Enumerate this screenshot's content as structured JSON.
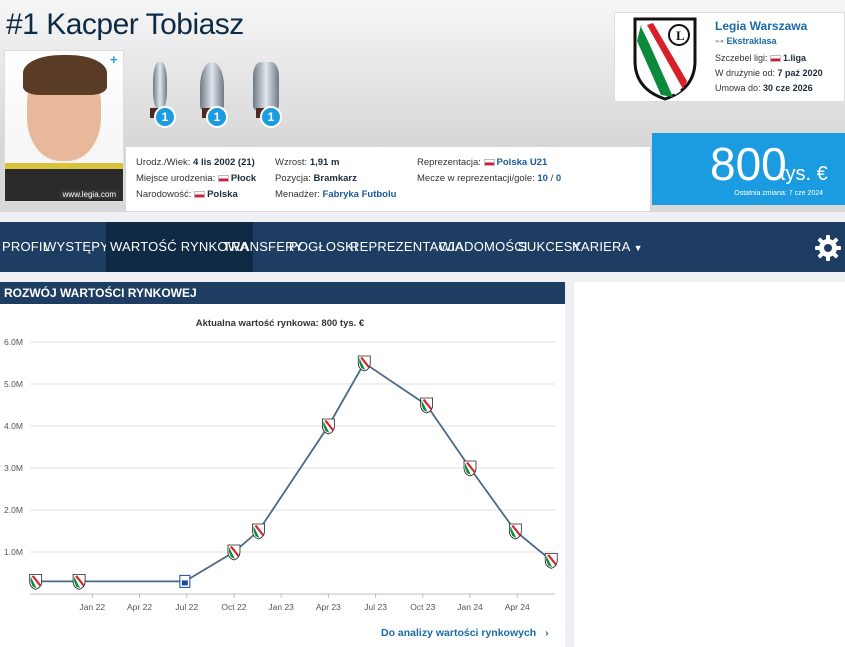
{
  "player": {
    "number": "#1",
    "first_name": "Kacper",
    "last_name": "Tobiasz",
    "photo_credit": "www.legia.com"
  },
  "trophies": [
    {
      "count": "1",
      "icon": "trophy-icon"
    },
    {
      "count": "1",
      "icon": "trophy-icon"
    },
    {
      "count": "1",
      "icon": "trophy-icon"
    }
  ],
  "details": {
    "birth_label": "Urodz./Wiek:",
    "birth_value": "4 lis 2002 (21)",
    "birthplace_label": "Miejsce urodzenia:",
    "birthplace_value": "Płock",
    "nationality_label": "Narodowość:",
    "nationality_value": "Polska",
    "height_label": "Wzrost:",
    "height_value": "1,91 m",
    "position_label": "Pozycja:",
    "position_value": "Bramkarz",
    "agent_label": "Menadżer:",
    "agent_value": "Fabryka Futbolu",
    "national_label": "Reprezentacja:",
    "national_value": "Polska U21",
    "caps_label": "Mecze w reprezentacji/gole:",
    "caps_value": "10",
    "goals_value": "0"
  },
  "club": {
    "name": "Legia Warszawa",
    "league": "Ekstraklasa",
    "tier_label": "Szczebel ligi:",
    "tier_value": "1.liga",
    "joined_label": "W drużynie od:",
    "joined_value": "7 paź 2020",
    "contract_label": "Umowa do:",
    "contract_value": "30 cze 2026"
  },
  "market_value": {
    "amount": "800",
    "unit": "tys. €",
    "last_change": "Ostatnia zmiana: 7 cze 2024"
  },
  "nav": [
    {
      "label": "PROFIL",
      "dropdown": false
    },
    {
      "label": "WYSTĘPY",
      "dropdown": true
    },
    {
      "label": "WARTOŚĆ RYNKOWA",
      "dropdown": false,
      "active": true
    },
    {
      "label": "TRANSFERY",
      "dropdown": false
    },
    {
      "label": "POGŁOSKI",
      "dropdown": false
    },
    {
      "label": "REPREZENTACJA",
      "dropdown": false
    },
    {
      "label": "WIADOMOŚCI",
      "dropdown": false
    },
    {
      "label": "SUKCESY",
      "dropdown": false
    },
    {
      "label": "KARIERA",
      "dropdown": true
    }
  ],
  "panel": {
    "title": "ROZWÓJ WARTOŚCI RYNKOWEJ",
    "link": "Do analizy wartości rynkowych",
    "link_arrow": "›"
  },
  "chart_data": {
    "type": "line",
    "title": "Aktualna wartość rynkowa: 800 tys. €",
    "ytick_labels": [
      "1.0M",
      "2.0M",
      "3.0M",
      "4.0M",
      "5.0M",
      "6.0M"
    ],
    "yticks": [
      1.0,
      2.0,
      3.0,
      4.0,
      5.0,
      6.0
    ],
    "ylim": [
      0,
      6.0
    ],
    "xtick_labels": [
      "Jan 22",
      "Apr 22",
      "Jul 22",
      "Oct 22",
      "Jan 23",
      "Apr 23",
      "Jul 23",
      "Oct 23",
      "Jan 24",
      "Apr 24"
    ],
    "xticks": [
      2022.0,
      2022.25,
      2022.5,
      2022.75,
      2023.0,
      2023.25,
      2023.5,
      2023.75,
      2024.0,
      2024.25
    ],
    "xlim": [
      2021.67,
      2024.45
    ],
    "grid": true,
    "series": [
      {
        "x": [
          2021.7,
          2021.93,
          2022.49,
          2022.75,
          2022.88,
          2023.25,
          2023.44,
          2023.77,
          2024.0,
          2024.24,
          2024.43
        ],
        "values": [
          0.3,
          0.3,
          0.3,
          1.0,
          1.5,
          4.0,
          5.5,
          4.5,
          3.0,
          1.5,
          0.8
        ],
        "markers": [
          "legia",
          "legia",
          "other",
          "legia",
          "legia",
          "legia",
          "legia",
          "legia",
          "legia",
          "legia",
          "legia"
        ]
      }
    ],
    "line_color": "#4a6a8a"
  }
}
